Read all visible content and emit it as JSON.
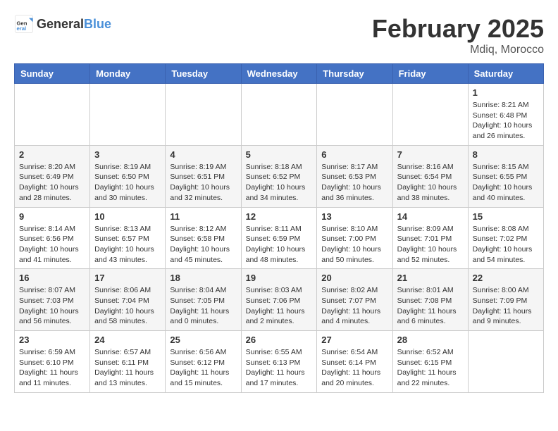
{
  "header": {
    "logo_general": "General",
    "logo_blue": "Blue",
    "month_title": "February 2025",
    "location": "Mdiq, Morocco"
  },
  "weekdays": [
    "Sunday",
    "Monday",
    "Tuesday",
    "Wednesday",
    "Thursday",
    "Friday",
    "Saturday"
  ],
  "weeks": [
    [
      {
        "day": "",
        "info": ""
      },
      {
        "day": "",
        "info": ""
      },
      {
        "day": "",
        "info": ""
      },
      {
        "day": "",
        "info": ""
      },
      {
        "day": "",
        "info": ""
      },
      {
        "day": "",
        "info": ""
      },
      {
        "day": "1",
        "info": "Sunrise: 8:21 AM\nSunset: 6:48 PM\nDaylight: 10 hours and 26 minutes."
      }
    ],
    [
      {
        "day": "2",
        "info": "Sunrise: 8:20 AM\nSunset: 6:49 PM\nDaylight: 10 hours and 28 minutes."
      },
      {
        "day": "3",
        "info": "Sunrise: 8:19 AM\nSunset: 6:50 PM\nDaylight: 10 hours and 30 minutes."
      },
      {
        "day": "4",
        "info": "Sunrise: 8:19 AM\nSunset: 6:51 PM\nDaylight: 10 hours and 32 minutes."
      },
      {
        "day": "5",
        "info": "Sunrise: 8:18 AM\nSunset: 6:52 PM\nDaylight: 10 hours and 34 minutes."
      },
      {
        "day": "6",
        "info": "Sunrise: 8:17 AM\nSunset: 6:53 PM\nDaylight: 10 hours and 36 minutes."
      },
      {
        "day": "7",
        "info": "Sunrise: 8:16 AM\nSunset: 6:54 PM\nDaylight: 10 hours and 38 minutes."
      },
      {
        "day": "8",
        "info": "Sunrise: 8:15 AM\nSunset: 6:55 PM\nDaylight: 10 hours and 40 minutes."
      }
    ],
    [
      {
        "day": "9",
        "info": "Sunrise: 8:14 AM\nSunset: 6:56 PM\nDaylight: 10 hours and 41 minutes."
      },
      {
        "day": "10",
        "info": "Sunrise: 8:13 AM\nSunset: 6:57 PM\nDaylight: 10 hours and 43 minutes."
      },
      {
        "day": "11",
        "info": "Sunrise: 8:12 AM\nSunset: 6:58 PM\nDaylight: 10 hours and 45 minutes."
      },
      {
        "day": "12",
        "info": "Sunrise: 8:11 AM\nSunset: 6:59 PM\nDaylight: 10 hours and 48 minutes."
      },
      {
        "day": "13",
        "info": "Sunrise: 8:10 AM\nSunset: 7:00 PM\nDaylight: 10 hours and 50 minutes."
      },
      {
        "day": "14",
        "info": "Sunrise: 8:09 AM\nSunset: 7:01 PM\nDaylight: 10 hours and 52 minutes."
      },
      {
        "day": "15",
        "info": "Sunrise: 8:08 AM\nSunset: 7:02 PM\nDaylight: 10 hours and 54 minutes."
      }
    ],
    [
      {
        "day": "16",
        "info": "Sunrise: 8:07 AM\nSunset: 7:03 PM\nDaylight: 10 hours and 56 minutes."
      },
      {
        "day": "17",
        "info": "Sunrise: 8:06 AM\nSunset: 7:04 PM\nDaylight: 10 hours and 58 minutes."
      },
      {
        "day": "18",
        "info": "Sunrise: 8:04 AM\nSunset: 7:05 PM\nDaylight: 11 hours and 0 minutes."
      },
      {
        "day": "19",
        "info": "Sunrise: 8:03 AM\nSunset: 7:06 PM\nDaylight: 11 hours and 2 minutes."
      },
      {
        "day": "20",
        "info": "Sunrise: 8:02 AM\nSunset: 7:07 PM\nDaylight: 11 hours and 4 minutes."
      },
      {
        "day": "21",
        "info": "Sunrise: 8:01 AM\nSunset: 7:08 PM\nDaylight: 11 hours and 6 minutes."
      },
      {
        "day": "22",
        "info": "Sunrise: 8:00 AM\nSunset: 7:09 PM\nDaylight: 11 hours and 9 minutes."
      }
    ],
    [
      {
        "day": "23",
        "info": "Sunrise: 6:59 AM\nSunset: 6:10 PM\nDaylight: 11 hours and 11 minutes."
      },
      {
        "day": "24",
        "info": "Sunrise: 6:57 AM\nSunset: 6:11 PM\nDaylight: 11 hours and 13 minutes."
      },
      {
        "day": "25",
        "info": "Sunrise: 6:56 AM\nSunset: 6:12 PM\nDaylight: 11 hours and 15 minutes."
      },
      {
        "day": "26",
        "info": "Sunrise: 6:55 AM\nSunset: 6:13 PM\nDaylight: 11 hours and 17 minutes."
      },
      {
        "day": "27",
        "info": "Sunrise: 6:54 AM\nSunset: 6:14 PM\nDaylight: 11 hours and 20 minutes."
      },
      {
        "day": "28",
        "info": "Sunrise: 6:52 AM\nSunset: 6:15 PM\nDaylight: 11 hours and 22 minutes."
      },
      {
        "day": "",
        "info": ""
      }
    ]
  ]
}
